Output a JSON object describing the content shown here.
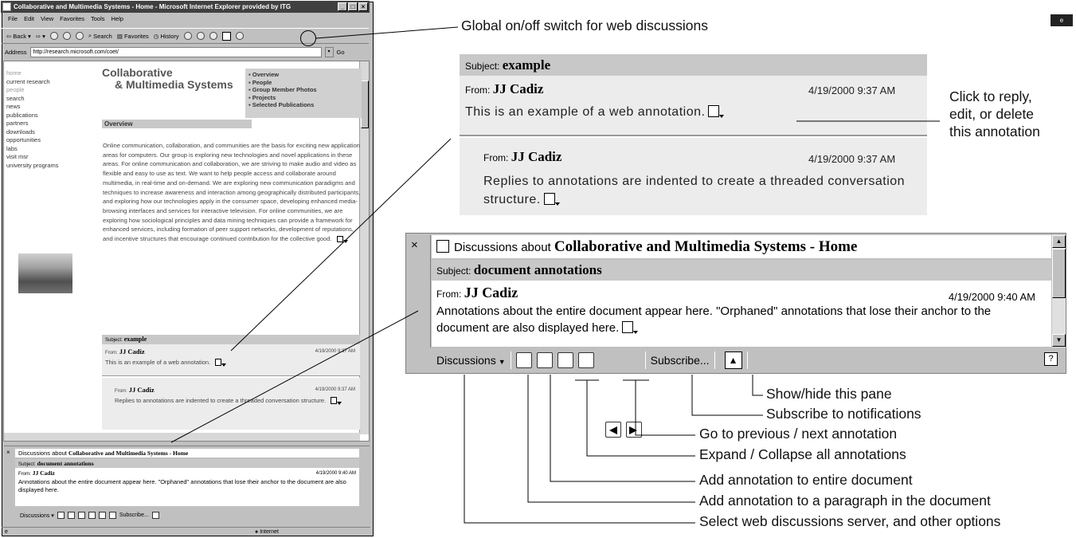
{
  "window": {
    "title": "Collaborative and Multimedia Systems - Home - Microsoft Internet Explorer provided by ITG",
    "menu": [
      "File",
      "Edit",
      "View",
      "Favorites",
      "Tools",
      "Help"
    ],
    "toolbar": [
      "Back",
      "Search",
      "Favorites",
      "History"
    ],
    "address_label": "Address",
    "address": "http://research.microsoft.com/coet/",
    "go": "Go",
    "status_zone": "Internet"
  },
  "page": {
    "nav": [
      "home",
      "current research",
      "people",
      "search",
      "news",
      "publications",
      "partners",
      "downloads",
      "opportunities",
      "labs",
      "visit msr",
      "university programs"
    ],
    "brand_line1": "Collaborative",
    "brand_line2": "& Multimedia Systems",
    "toc": [
      "Overview",
      "People",
      "Group Member Photos",
      "Projects",
      "Selected Publications"
    ],
    "section": "Overview",
    "paragraph": "Online communication, collaboration, and communities are the basis for exciting new application areas for computers. Our group is exploring new technologies and novel applications in these areas. For online communication and collaboration, we are striving to make audio and video as flexible and easy to use as text. We want to help people access and collaborate around multimedia, in real-time and on-demand. We are exploring new communication paradigms and techniques to increase awareness and interaction among geographically distributed participants, and exploring how our technologies apply in the consumer space, developing enhanced media-browsing interfaces and services for interactive television. For online communities, we are exploring how sociological principles and data mining techniques can provide a framework for enhanced services, including formation of peer support networks, development of reputations, and incentive structures that encourage continued contribution for the collective good."
  },
  "discussion": {
    "subject_label": "Subject:",
    "subject": "example",
    "from_label": "From:",
    "author": "JJ Cadiz",
    "date": "4/19/2000 9:37 AM",
    "text": "This is an example of a web annotation.",
    "reply_author": "JJ Cadiz",
    "reply_date": "4/19/2000 9:37 AM",
    "reply_text": "Replies to annotations are indented to create a threaded conversation structure."
  },
  "pane": {
    "close": "×",
    "title_prefix": "Discussions about",
    "title_bold": "Collaborative and Multimedia Systems - Home",
    "subject_label": "Subject:",
    "subject": "document annotations",
    "from_label": "From:",
    "author": "JJ Cadiz",
    "date": "4/19/2000 9:40 AM",
    "text": "Annotations about the entire document appear here.  \"Orphaned\" annotations that lose their anchor to the document are also displayed here.",
    "discussions_btn": "Discussions",
    "subscribe_btn": "Subscribe..."
  },
  "callouts": {
    "global_switch": "Global on/off switch for web discussions",
    "reply_l1": "Click to reply,",
    "reply_l2": "edit, or delete",
    "reply_l3": "this annotation",
    "show_hide": "Show/hide this pane",
    "subscribe": "Subscribe to notifications",
    "prev_next": "Go to previous / next annotation",
    "expand": "Expand / Collapse all annotations",
    "add_doc": "Add annotation to entire document",
    "add_para": "Add annotation to a paragraph in the document",
    "select_server": "Select web discussions server, and other options"
  }
}
